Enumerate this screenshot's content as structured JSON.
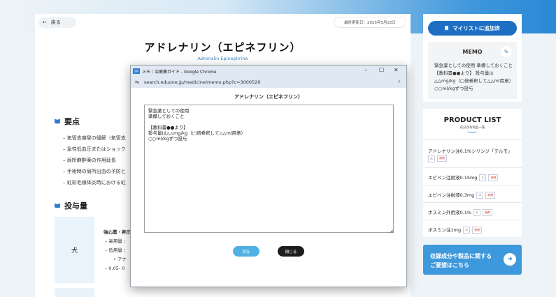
{
  "page": {
    "back_label": "戻る",
    "updated": "最終更新日：2025年5月22日",
    "title": "アドレナリン（エピネフリン）",
    "subtitle": "Adrenalin Epinephrine",
    "points_heading": "要点",
    "points": [
      "気管支痙攣の緩解（気管支",
      "急性低血圧またはショック",
      "局所麻酔薬の作用延長",
      "手術時の局所出血の予防と",
      "虹彩毛様体炎時における虹"
    ],
    "dosage_heading": "投与量",
    "dosage_species": "犬",
    "dosage_lines": [
      "強心薬・昇圧",
      "– 高用量 ：",
      "– 低用量 ：",
      "• アナ",
      "– 0.05- 0"
    ]
  },
  "sidebar": {
    "mylist_label": "マイリストに追加済",
    "memo_title": "MEMO",
    "memo_lines": [
      "緊急薬としての使用 準備しておくこと",
      "【教科書●●より】 投与量は",
      "△△mg/kg（□倍希釈して△△ml用意）",
      "○○ml/kgずつ投与"
    ],
    "product_list_title": "PRODUCT LIST",
    "product_list_sub": "成分含有製品一覧",
    "products": [
      {
        "name": "アドレナリン注0.1%シリンジ「テルモ」",
        "tags": [
          "人",
          "液剤"
        ]
      },
      {
        "name": "エピペン注射液0.15mg",
        "tags": [
          "人",
          "液剤"
        ]
      },
      {
        "name": "エピペン注射液0.3mg",
        "tags": [
          "人",
          "液剤"
        ]
      },
      {
        "name": "ボスミン外用液0.1%",
        "tags": [
          "人",
          "液剤"
        ]
      },
      {
        "name": "ボスミン注1mg",
        "tags": [
          "人",
          "液剤"
        ]
      }
    ],
    "request_line1": "収録成分や製品に関する",
    "request_line2": "ご要望はこちら"
  },
  "popup": {
    "window_title": "メモ｜治療薬ガイド - Google Chrome",
    "url": "search.eduone.jp/medicine/memo.php?c=3000529",
    "heading": "アドレナリン（エピネフリン）",
    "memo_text": "緊急薬としての使用\n準備しておくこと\n\n【教科書●●より】\n投与量は△△mg/kg（□倍希釈して△△ml用意）\n○○ml/kgずつ投与",
    "save_label": "保存",
    "close_label": "閉じる"
  }
}
